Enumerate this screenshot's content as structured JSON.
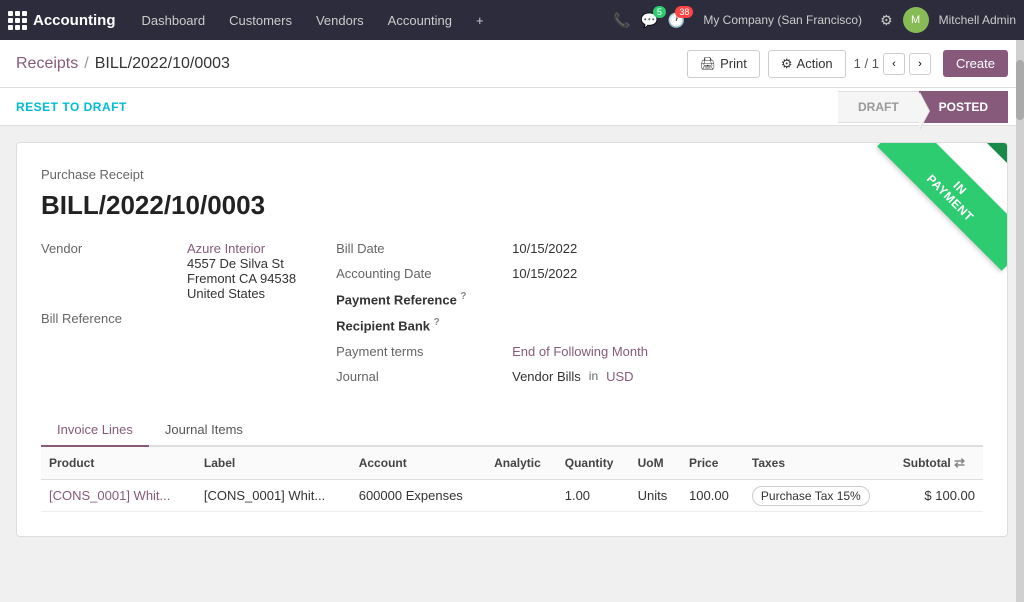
{
  "app": {
    "name": "Accounting",
    "nav_items": [
      "Dashboard",
      "Customers",
      "Vendors",
      "Accounting"
    ],
    "plus_btn": "+",
    "icons": {
      "phone": "📞",
      "chat": "💬",
      "clock": "🕐",
      "settings": "⚙",
      "user": "👤"
    },
    "chat_badge": "5",
    "clock_badge": "38",
    "company": "My Company (San Francisco)",
    "user_name": "Mitchell Admin"
  },
  "breadcrumb": {
    "parent": "Receipts",
    "separator": "/",
    "current": "BILL/2022/10/0003"
  },
  "toolbar": {
    "print_label": "Print",
    "action_label": "Action",
    "action_count": "0 Action",
    "page_info": "1 / 1",
    "create_label": "Create"
  },
  "status_bar": {
    "reset_label": "RESET TO DRAFT",
    "stages": [
      "DRAFT",
      "POSTED"
    ]
  },
  "document": {
    "type": "Purchase Receipt",
    "title": "BILL/2022/10/0003",
    "ribbon_text": "IN PAYMENT",
    "vendor_label": "Vendor",
    "vendor_name": "Azure Interior",
    "vendor_address_1": "4557 De Silva St",
    "vendor_address_2": "Fremont CA 94538",
    "vendor_address_3": "United States",
    "bill_ref_label": "Bill Reference",
    "bill_date_label": "Bill Date",
    "bill_date_value": "10/15/2022",
    "accounting_date_label": "Accounting Date",
    "accounting_date_value": "10/15/2022",
    "payment_ref_label": "Payment Reference",
    "payment_ref_value": "",
    "recipient_bank_label": "Recipient Bank",
    "recipient_bank_value": "",
    "payment_terms_label": "Payment terms",
    "payment_terms_value": "End of Following Month",
    "journal_label": "Journal",
    "journal_value": "Vendor Bills",
    "journal_in": "in",
    "journal_currency": "USD"
  },
  "tabs": [
    {
      "id": "invoice-lines",
      "label": "Invoice Lines",
      "active": true
    },
    {
      "id": "journal-items",
      "label": "Journal Items",
      "active": false
    }
  ],
  "invoice_lines_table": {
    "columns": [
      {
        "id": "product",
        "label": "Product"
      },
      {
        "id": "label",
        "label": "Label"
      },
      {
        "id": "account",
        "label": "Account"
      },
      {
        "id": "analytic",
        "label": "Analytic"
      },
      {
        "id": "quantity",
        "label": "Quantity"
      },
      {
        "id": "uom",
        "label": "UoM"
      },
      {
        "id": "price",
        "label": "Price"
      },
      {
        "id": "taxes",
        "label": "Taxes"
      },
      {
        "id": "subtotal",
        "label": "Subtotal"
      }
    ],
    "rows": [
      {
        "product": "[CONS_0001] Whit...",
        "label": "[CONS_0001] Whit...",
        "account": "600000 Expenses",
        "analytic": "",
        "quantity": "1.00",
        "uom": "Units",
        "price": "100.00",
        "tax": "Purchase Tax 15%",
        "subtotal": "$ 100.00"
      }
    ]
  }
}
